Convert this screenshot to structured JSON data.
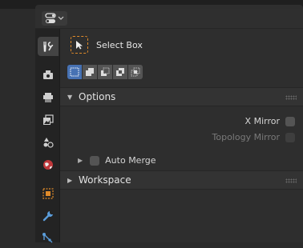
{
  "editor": {
    "type_icon": "properties-editor-icon"
  },
  "tabs": [
    {
      "icon": "tool-icon",
      "active": true
    },
    {
      "icon": "render-icon"
    },
    {
      "icon": "output-icon"
    },
    {
      "icon": "view-layer-icon"
    },
    {
      "icon": "scene-icon"
    },
    {
      "icon": "world-icon"
    },
    {
      "icon": "object-icon"
    },
    {
      "icon": "modifier-icon"
    },
    {
      "icon": "particles-icon"
    }
  ],
  "active_tool": {
    "icon": "select-box-icon",
    "label": "Select Box"
  },
  "mode_buttons": [
    {
      "name": "mode-new",
      "active": true
    },
    {
      "name": "mode-extend"
    },
    {
      "name": "mode-subtract"
    },
    {
      "name": "mode-invert"
    },
    {
      "name": "mode-intersect"
    }
  ],
  "options": {
    "label": "Options",
    "x_mirror": "X Mirror",
    "topology_mirror": "Topology Mirror",
    "auto_merge": "Auto Merge"
  },
  "workspace": {
    "label": "Workspace"
  },
  "colors": {
    "accent": "#4772b3",
    "tool_outline": "#e08b2a"
  }
}
